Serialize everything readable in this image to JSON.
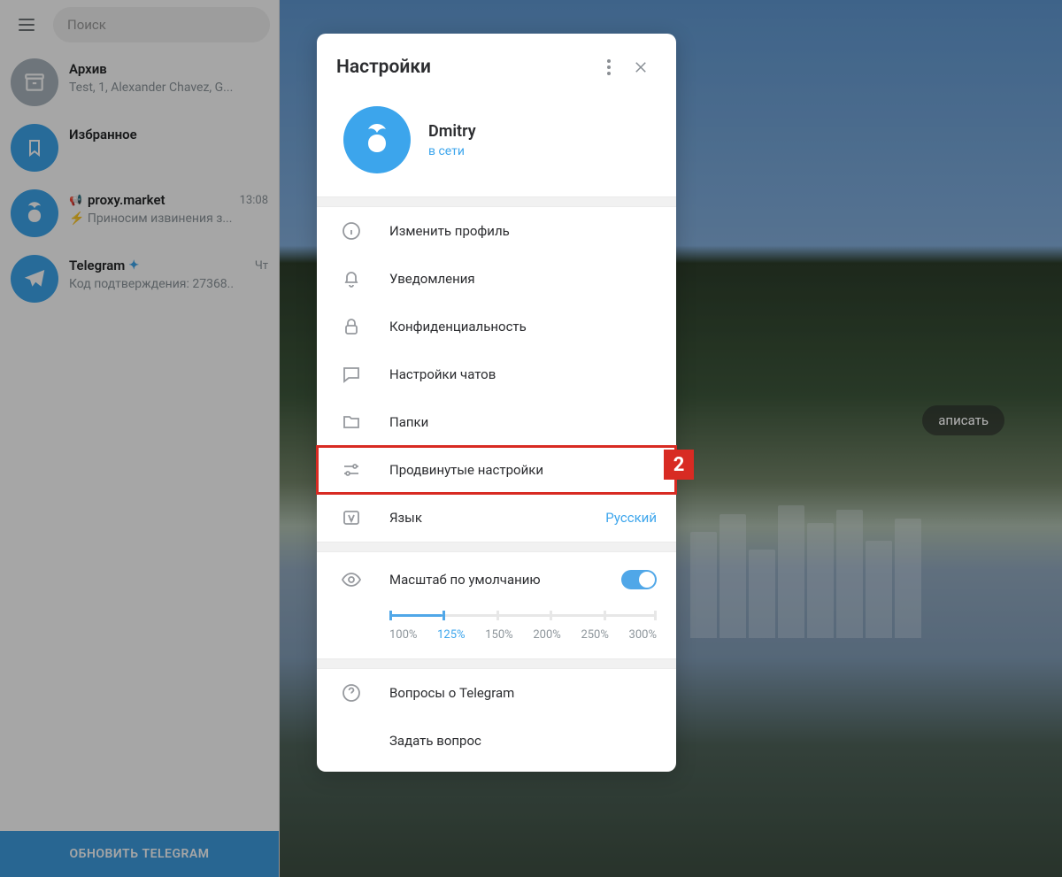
{
  "sidebar": {
    "search_placeholder": "Поиск",
    "chats": [
      {
        "name": "Архив",
        "preview": "Test, 1, Alexander Chavez, G..."
      },
      {
        "name": "Избранное",
        "preview": ""
      },
      {
        "name": "proxy.market",
        "preview": "⚡ Приносим извинения з...",
        "time": "13:08",
        "megaphone": true
      },
      {
        "name": "Telegram",
        "preview": "Код подтверждения: 27368..",
        "time": "Чт",
        "verified": true
      }
    ],
    "update_label": "ОБНОВИТЬ TELEGRAM"
  },
  "background_pill": "аписать",
  "modal": {
    "title": "Настройки",
    "profile": {
      "name": "Dmitry",
      "status": "в сети"
    },
    "items": {
      "edit_profile": "Изменить профиль",
      "notifications": "Уведомления",
      "privacy": "Конфиденциальность",
      "chat_settings": "Настройки чатов",
      "folders": "Папки",
      "advanced": "Продвинутые настройки",
      "language": "Язык",
      "language_value": "Русский"
    },
    "scale": {
      "label": "Масштаб по умолчанию",
      "options": [
        "100%",
        "125%",
        "150%",
        "200%",
        "250%",
        "300%"
      ],
      "current_index": 1
    },
    "help": {
      "faq": "Вопросы о Telegram",
      "ask": "Задать вопрос"
    },
    "highlight_badge": "2"
  }
}
